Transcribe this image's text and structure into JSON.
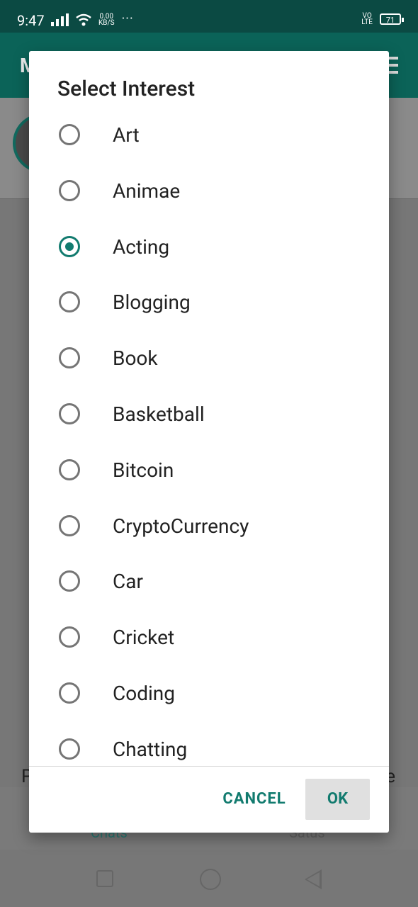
{
  "status_bar": {
    "time": "9:47",
    "speed_value": "0.00",
    "speed_unit": "KB/S",
    "more": "···",
    "volte_top": "VO",
    "volte_bottom": "LTE",
    "battery": "71"
  },
  "background": {
    "peek_left": "P",
    "peek_right": "e",
    "nav_chats": "Chats",
    "nav_status": "Satus"
  },
  "dialog": {
    "title": "Select Interest",
    "options": [
      {
        "label": "Art",
        "checked": false
      },
      {
        "label": "Animae",
        "checked": false
      },
      {
        "label": "Acting",
        "checked": true
      },
      {
        "label": "Blogging",
        "checked": false
      },
      {
        "label": "Book",
        "checked": false
      },
      {
        "label": "Basketball",
        "checked": false
      },
      {
        "label": "Bitcoin",
        "checked": false
      },
      {
        "label": "CryptoCurrency",
        "checked": false
      },
      {
        "label": "Car",
        "checked": false
      },
      {
        "label": "Cricket",
        "checked": false
      },
      {
        "label": "Coding",
        "checked": false
      },
      {
        "label": "Chatting",
        "checked": false
      }
    ],
    "cancel_label": "CANCEL",
    "ok_label": "OK"
  },
  "colors": {
    "accent": "#127b6f",
    "header": "#0b6358",
    "status_bar": "#0b4a43"
  }
}
